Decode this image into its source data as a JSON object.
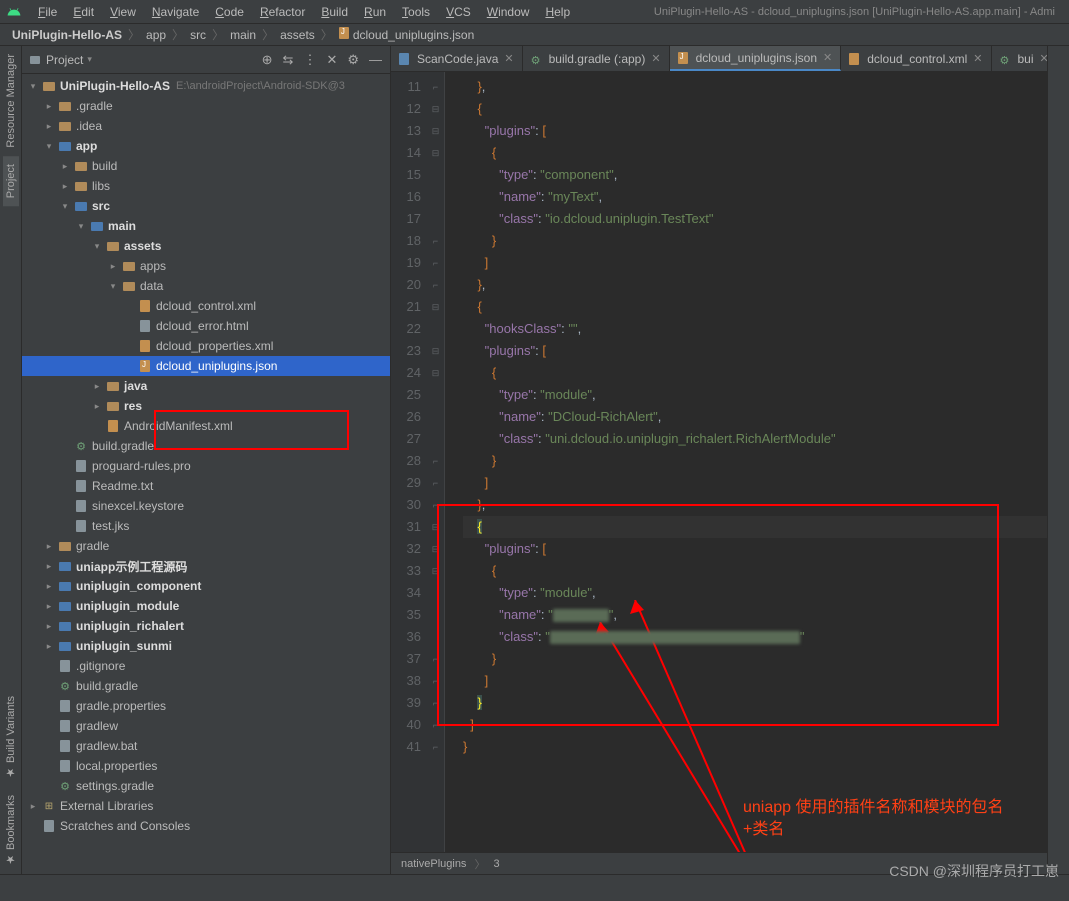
{
  "window": {
    "title_path": "UniPlugin-Hello-AS - dcloud_uniplugins.json [UniPlugin-Hello-AS.app.main] - Admi"
  },
  "menu": [
    "File",
    "Edit",
    "View",
    "Navigate",
    "Code",
    "Refactor",
    "Build",
    "Run",
    "Tools",
    "VCS",
    "Window",
    "Help"
  ],
  "breadcrumb": {
    "items": [
      {
        "t": "UniPlugin-Hello-AS",
        "bold": true
      },
      {
        "t": "app"
      },
      {
        "t": "src"
      },
      {
        "t": "main"
      },
      {
        "t": "assets"
      },
      {
        "t": "dcloud_uniplugins.json",
        "icon": true
      }
    ]
  },
  "left_tools": {
    "top": [
      {
        "l": "Resource Manager"
      },
      {
        "l": "Project",
        "active": true
      }
    ],
    "bottom": [
      {
        "l": "Build Variants"
      },
      {
        "l": "Bookmarks"
      }
    ]
  },
  "project_panel": {
    "title": "Project",
    "actions": [
      "⊕",
      "⇆",
      "⋮",
      "✕",
      "⚙",
      "—"
    ]
  },
  "tree": [
    {
      "d": 0,
      "a": "open",
      "i": "folder",
      "l": "UniPlugin-Hello-AS",
      "bold": true,
      "hint": "E:\\androidProject\\Android-SDK@3"
    },
    {
      "d": 1,
      "a": "closed",
      "i": "folder",
      "l": ".gradle"
    },
    {
      "d": 1,
      "a": "closed",
      "i": "folder",
      "l": ".idea"
    },
    {
      "d": 1,
      "a": "open",
      "i": "mod",
      "l": "app",
      "bold": true
    },
    {
      "d": 2,
      "a": "closed",
      "i": "folder",
      "l": "build"
    },
    {
      "d": 2,
      "a": "closed",
      "i": "folder",
      "l": "libs"
    },
    {
      "d": 2,
      "a": "open",
      "i": "mod",
      "l": "src",
      "bold": true
    },
    {
      "d": 3,
      "a": "open",
      "i": "mod",
      "l": "main",
      "bold": true
    },
    {
      "d": 4,
      "a": "open",
      "i": "folder",
      "l": "assets",
      "bold": true
    },
    {
      "d": 5,
      "a": "closed",
      "i": "folder",
      "l": "apps"
    },
    {
      "d": 5,
      "a": "open",
      "i": "folder",
      "l": "data"
    },
    {
      "d": 6,
      "a": "none",
      "i": "xml",
      "l": "dcloud_control.xml"
    },
    {
      "d": 6,
      "a": "none",
      "i": "file",
      "l": "dcloud_error.html"
    },
    {
      "d": 6,
      "a": "none",
      "i": "xml",
      "l": "dcloud_properties.xml"
    },
    {
      "d": 6,
      "a": "none",
      "i": "json",
      "l": "dcloud_uniplugins.json",
      "selected": true
    },
    {
      "d": 4,
      "a": "closed",
      "i": "folder",
      "l": "java",
      "bold": true
    },
    {
      "d": 4,
      "a": "closed",
      "i": "folder",
      "l": "res",
      "bold": true
    },
    {
      "d": 4,
      "a": "none",
      "i": "xml",
      "l": "AndroidManifest.xml"
    },
    {
      "d": 2,
      "a": "none",
      "i": "gradle",
      "l": "build.gradle"
    },
    {
      "d": 2,
      "a": "none",
      "i": "file",
      "l": "proguard-rules.pro"
    },
    {
      "d": 2,
      "a": "none",
      "i": "file",
      "l": "Readme.txt"
    },
    {
      "d": 2,
      "a": "none",
      "i": "file",
      "l": "sinexcel.keystore"
    },
    {
      "d": 2,
      "a": "none",
      "i": "file",
      "l": "test.jks"
    },
    {
      "d": 1,
      "a": "closed",
      "i": "folder",
      "l": "gradle"
    },
    {
      "d": 1,
      "a": "closed",
      "i": "mod",
      "l": "uniapp示例工程源码",
      "bold": true
    },
    {
      "d": 1,
      "a": "closed",
      "i": "mod",
      "l": "uniplugin_component",
      "bold": true
    },
    {
      "d": 1,
      "a": "closed",
      "i": "mod",
      "l": "uniplugin_module",
      "bold": true
    },
    {
      "d": 1,
      "a": "closed",
      "i": "mod",
      "l": "uniplugin_richalert",
      "bold": true
    },
    {
      "d": 1,
      "a": "closed",
      "i": "mod",
      "l": "uniplugin_sunmi",
      "bold": true
    },
    {
      "d": 1,
      "a": "none",
      "i": "file",
      "l": ".gitignore"
    },
    {
      "d": 1,
      "a": "none",
      "i": "gradle",
      "l": "build.gradle"
    },
    {
      "d": 1,
      "a": "none",
      "i": "file",
      "l": "gradle.properties"
    },
    {
      "d": 1,
      "a": "none",
      "i": "file",
      "l": "gradlew"
    },
    {
      "d": 1,
      "a": "none",
      "i": "file",
      "l": "gradlew.bat"
    },
    {
      "d": 1,
      "a": "none",
      "i": "file",
      "l": "local.properties"
    },
    {
      "d": 1,
      "a": "none",
      "i": "gradle",
      "l": "settings.gradle"
    },
    {
      "d": 0,
      "a": "closed",
      "i": "lib",
      "l": "External Libraries"
    },
    {
      "d": 0,
      "a": "none",
      "i": "file",
      "l": "Scratches and Consoles"
    }
  ],
  "tabs": [
    {
      "l": "ScanCode.java",
      "i": "java"
    },
    {
      "l": "build.gradle (:app)",
      "i": "gradle"
    },
    {
      "l": "dcloud_uniplugins.json",
      "i": "json",
      "active": true
    },
    {
      "l": "dcloud_control.xml",
      "i": "xml"
    },
    {
      "l": "bui",
      "i": "gradle"
    }
  ],
  "code": {
    "start": 11,
    "lines": [
      [
        {
          "t": "    ",
          "c": "plain"
        },
        {
          "t": "}",
          "c": "punc"
        },
        {
          "t": ",",
          "c": "plain"
        }
      ],
      [
        {
          "t": "    ",
          "c": "plain"
        },
        {
          "t": "{",
          "c": "punc"
        }
      ],
      [
        {
          "t": "      ",
          "c": "plain"
        },
        {
          "t": "\"plugins\"",
          "c": "key"
        },
        {
          "t": ": ",
          "c": "plain"
        },
        {
          "t": "[",
          "c": "punc"
        }
      ],
      [
        {
          "t": "        ",
          "c": "plain"
        },
        {
          "t": "{",
          "c": "punc"
        }
      ],
      [
        {
          "t": "          ",
          "c": "plain"
        },
        {
          "t": "\"type\"",
          "c": "key"
        },
        {
          "t": ": ",
          "c": "plain"
        },
        {
          "t": "\"component\"",
          "c": "str"
        },
        {
          "t": ",",
          "c": "plain"
        }
      ],
      [
        {
          "t": "          ",
          "c": "plain"
        },
        {
          "t": "\"name\"",
          "c": "key"
        },
        {
          "t": ": ",
          "c": "plain"
        },
        {
          "t": "\"myText\"",
          "c": "str"
        },
        {
          "t": ",",
          "c": "plain"
        }
      ],
      [
        {
          "t": "          ",
          "c": "plain"
        },
        {
          "t": "\"class\"",
          "c": "key"
        },
        {
          "t": ": ",
          "c": "plain"
        },
        {
          "t": "\"io.dcloud.uniplugin.TestText\"",
          "c": "str"
        }
      ],
      [
        {
          "t": "        ",
          "c": "plain"
        },
        {
          "t": "}",
          "c": "punc"
        }
      ],
      [
        {
          "t": "      ",
          "c": "plain"
        },
        {
          "t": "]",
          "c": "punc"
        }
      ],
      [
        {
          "t": "    ",
          "c": "plain"
        },
        {
          "t": "}",
          "c": "punc"
        },
        {
          "t": ",",
          "c": "plain"
        }
      ],
      [
        {
          "t": "    ",
          "c": "plain"
        },
        {
          "t": "{",
          "c": "punc"
        }
      ],
      [
        {
          "t": "      ",
          "c": "plain"
        },
        {
          "t": "\"hooksClass\"",
          "c": "key"
        },
        {
          "t": ": ",
          "c": "plain"
        },
        {
          "t": "\"\"",
          "c": "str"
        },
        {
          "t": ",",
          "c": "plain"
        }
      ],
      [
        {
          "t": "      ",
          "c": "plain"
        },
        {
          "t": "\"plugins\"",
          "c": "key"
        },
        {
          "t": ": ",
          "c": "plain"
        },
        {
          "t": "[",
          "c": "punc"
        }
      ],
      [
        {
          "t": "        ",
          "c": "plain"
        },
        {
          "t": "{",
          "c": "punc"
        }
      ],
      [
        {
          "t": "          ",
          "c": "plain"
        },
        {
          "t": "\"type\"",
          "c": "key"
        },
        {
          "t": ": ",
          "c": "plain"
        },
        {
          "t": "\"module\"",
          "c": "str"
        },
        {
          "t": ",",
          "c": "plain"
        }
      ],
      [
        {
          "t": "          ",
          "c": "plain"
        },
        {
          "t": "\"name\"",
          "c": "key"
        },
        {
          "t": ": ",
          "c": "plain"
        },
        {
          "t": "\"DCloud-RichAlert\"",
          "c": "str"
        },
        {
          "t": ",",
          "c": "plain"
        }
      ],
      [
        {
          "t": "          ",
          "c": "plain"
        },
        {
          "t": "\"class\"",
          "c": "key"
        },
        {
          "t": ": ",
          "c": "plain"
        },
        {
          "t": "\"uni.dcloud.io.uniplugin_richalert.RichAlertModule\"",
          "c": "str"
        }
      ],
      [
        {
          "t": "        ",
          "c": "plain"
        },
        {
          "t": "}",
          "c": "punc"
        }
      ],
      [
        {
          "t": "      ",
          "c": "plain"
        },
        {
          "t": "]",
          "c": "punc"
        }
      ],
      [
        {
          "t": "    ",
          "c": "plain"
        },
        {
          "t": "}",
          "c": "punc"
        },
        {
          "t": ",",
          "c": "plain"
        }
      ],
      [
        {
          "t": "    ",
          "c": "plain"
        },
        {
          "t": "{",
          "c": "bracket-hl"
        }
      ],
      [
        {
          "t": "      ",
          "c": "plain"
        },
        {
          "t": "\"plugins\"",
          "c": "key"
        },
        {
          "t": ": ",
          "c": "plain"
        },
        {
          "t": "[",
          "c": "punc"
        }
      ],
      [
        {
          "t": "        ",
          "c": "plain"
        },
        {
          "t": "{",
          "c": "punc"
        }
      ],
      [
        {
          "t": "          ",
          "c": "plain"
        },
        {
          "t": "\"type\"",
          "c": "key"
        },
        {
          "t": ": ",
          "c": "plain"
        },
        {
          "t": "\"module\"",
          "c": "str"
        },
        {
          "t": ",",
          "c": "plain"
        }
      ],
      [
        {
          "t": "          ",
          "c": "plain"
        },
        {
          "t": "\"name\"",
          "c": "key"
        },
        {
          "t": ": ",
          "c": "plain"
        },
        {
          "t": "\"",
          "c": "str"
        },
        {
          "t": "",
          "c": "redacted"
        },
        {
          "t": "\"",
          "c": "str"
        },
        {
          "t": ",",
          "c": "plain"
        }
      ],
      [
        {
          "t": "          ",
          "c": "plain"
        },
        {
          "t": "\"class\"",
          "c": "key"
        },
        {
          "t": ": ",
          "c": "plain"
        },
        {
          "t": "\"",
          "c": "str"
        },
        {
          "t": "",
          "c": "redacted long"
        },
        {
          "t": "\"",
          "c": "str"
        }
      ],
      [
        {
          "t": "        ",
          "c": "plain"
        },
        {
          "t": "}",
          "c": "punc"
        }
      ],
      [
        {
          "t": "      ",
          "c": "plain"
        },
        {
          "t": "]",
          "c": "punc"
        }
      ],
      [
        {
          "t": "    ",
          "c": "plain"
        },
        {
          "t": "}",
          "c": "bracket-hl"
        }
      ],
      [
        {
          "t": "  ",
          "c": "plain"
        },
        {
          "t": "]",
          "c": "punc"
        }
      ],
      [
        {
          "t": "}",
          "c": "punc"
        }
      ]
    ],
    "current_line": 31
  },
  "editor_status": {
    "path": [
      "nativePlugins",
      "3"
    ]
  },
  "annotation": {
    "line1": "uniapp 使用的插件名称和模块的包名",
    "line2": "+类名"
  },
  "watermark": "CSDN @深圳程序员打工崽"
}
